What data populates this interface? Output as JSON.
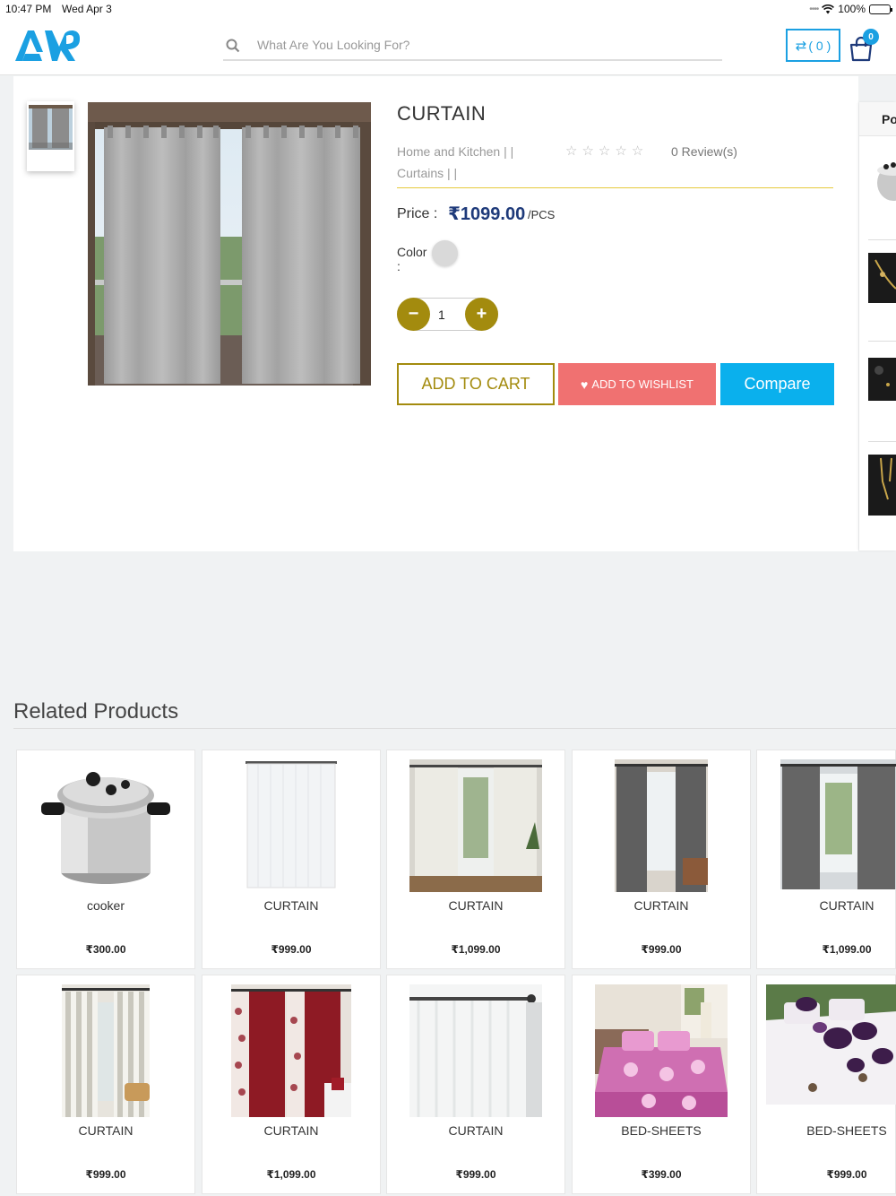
{
  "status": {
    "time": "10:47 PM",
    "date": "Wed Apr 3",
    "battery": "100%"
  },
  "search": {
    "placeholder": "What Are You Looking For?"
  },
  "compare_btn": {
    "label": "( 0 )"
  },
  "cart": {
    "count": "0"
  },
  "product": {
    "title": "CURTAIN",
    "category": "Home and Kitchen | |",
    "subcategory": "Curtains | |",
    "reviews": "0 Review(s)",
    "rating": 0,
    "price_label": "Price :",
    "price": "₹1099.00",
    "unit": "/PCS",
    "color_label": "Color :",
    "color_swatch": "#d9d9d9",
    "quantity": "1",
    "add_to_cart": "ADD TO CART",
    "add_to_wishlist": "ADD TO WISHLIST",
    "compare": "Compare"
  },
  "popular": {
    "heading": "Po"
  },
  "related": {
    "title": "Related Products",
    "items": [
      {
        "name": "cooker",
        "price": "₹300.00"
      },
      {
        "name": "CURTAIN",
        "price": "₹999.00"
      },
      {
        "name": "CURTAIN",
        "price": "₹1,099.00"
      },
      {
        "name": "CURTAIN",
        "price": "₹999.00"
      },
      {
        "name": "CURTAIN",
        "price": "₹1,099.00"
      },
      {
        "name": "CURTAIN",
        "price": "₹999.00"
      },
      {
        "name": "CURTAIN",
        "price": "₹1,099.00"
      },
      {
        "name": "CURTAIN",
        "price": "₹999.00"
      },
      {
        "name": "BED-SHEETS",
        "price": "₹399.00"
      },
      {
        "name": "BED-SHEETS",
        "price": "₹999.00"
      }
    ]
  },
  "colors": {
    "accent_blue": "#1ba0e2",
    "gold": "#a38b0e",
    "wishlist": "#f07171",
    "compare": "#0ab0ed",
    "price": "#1e3a7a"
  }
}
